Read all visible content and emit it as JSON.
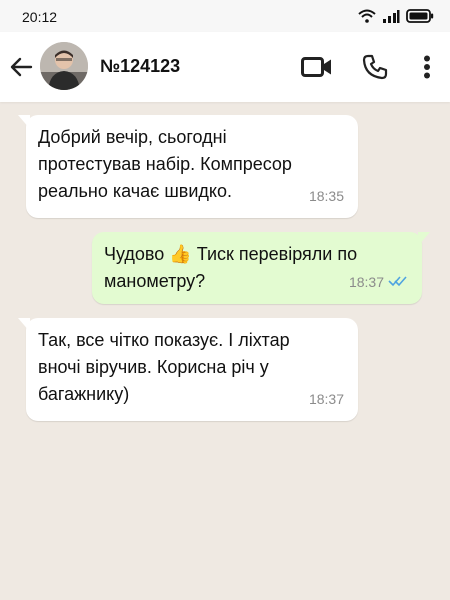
{
  "status_bar": {
    "time": "20:12",
    "icons": [
      "wifi-icon",
      "signal-icon",
      "battery-icon"
    ]
  },
  "header": {
    "contact_name": "№124123",
    "avatar": "avatar",
    "icons": [
      "back-arrow-icon",
      "video-call-icon",
      "phone-icon",
      "more-vert-icon"
    ]
  },
  "messages": [
    {
      "direction": "incoming",
      "lines": [
        "Добрий вечір, сьогодні",
        "протестував набір. Компресор",
        "реально качає швидко."
      ],
      "time": "18:35"
    },
    {
      "direction": "outgoing",
      "text_before_emoji": "Чудово",
      "emoji": "👍",
      "lines": [
        "Тиск перевіряли по",
        "манометру?"
      ],
      "time": "18:37",
      "status": "read"
    },
    {
      "direction": "incoming",
      "lines": [
        "Так, все чітко показує. І ліхтар",
        "вночі віручив. Корисна річ у",
        "багажнику)"
      ],
      "time": "18:37"
    }
  ],
  "colors": {
    "chat_background": "#efe9e2",
    "incoming_bubble": "#ffffff",
    "outgoing_bubble": "#e3fbd1",
    "read_ticks": "#4fa3e0"
  }
}
